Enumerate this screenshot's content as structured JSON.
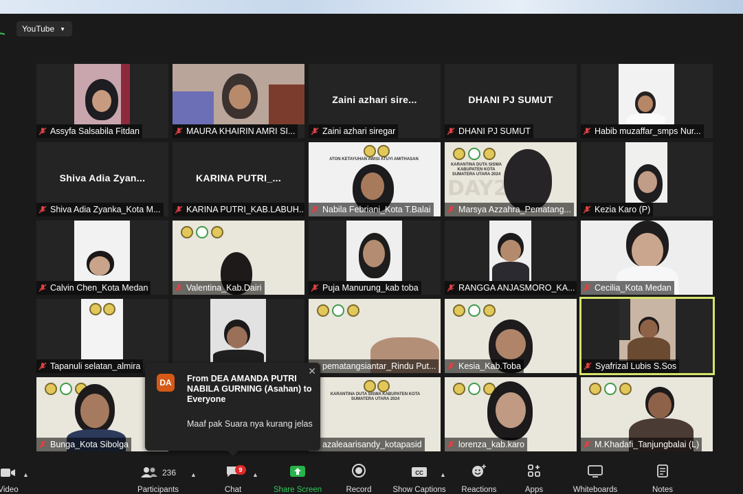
{
  "top_bar": {
    "stream_label": "YouTube"
  },
  "tiles": [
    {
      "name": "Assyfa Salsabila Fitdan",
      "display": ""
    },
    {
      "name": "MAURA KHAIRIN AMRI SI...",
      "display": ""
    },
    {
      "name": "Zaini azhari siregar",
      "display": "Zaini azhari sire..."
    },
    {
      "name": "DHANI PJ SUMUT",
      "display": "DHANI PJ SUMUT"
    },
    {
      "name": "Habib muzaffar_smps Nur...",
      "display": ""
    },
    {
      "name": "Shiva Adia Zyanka_Kota M...",
      "display": "Shiva Adia Zyan..."
    },
    {
      "name": "KARINA PUTRI_KAB.LABUH...",
      "display": "KARINA PUTRI_..."
    },
    {
      "name": "Nabila Febriani_Kota T.Balai",
      "display": ""
    },
    {
      "name": "Marsya Azzahra_Pematang...",
      "display": ""
    },
    {
      "name": "Kezia Karo (P)",
      "display": ""
    },
    {
      "name": "Calvin Chen_Kota Medan",
      "display": ""
    },
    {
      "name": "Valentina_Kab.Dairi",
      "display": ""
    },
    {
      "name": "Puja Manurung_kab toba",
      "display": ""
    },
    {
      "name": "RANGGA ANJASMORO_KA...",
      "display": ""
    },
    {
      "name": "Cecilia_Kota Medan",
      "display": ""
    },
    {
      "name": "Tapanuli selatan_almira",
      "display": ""
    },
    {
      "name": "",
      "display": ""
    },
    {
      "name": "pematangsiantar_Rindu Put...",
      "display": ""
    },
    {
      "name": "Kesia_Kab.Toba",
      "display": ""
    },
    {
      "name": "Syafrizal Lubis S.Sos",
      "display": ""
    },
    {
      "name": "Bunga_Kota Sibolga",
      "display": ""
    },
    {
      "name": "",
      "display": ""
    },
    {
      "name": "azaleaarisandy_kotapasid",
      "display": ""
    },
    {
      "name": "lorenza_kab.karo",
      "display": ""
    },
    {
      "name": "M.Khadafi_Tanjungbalai (L)",
      "display": ""
    }
  ],
  "banner_text": {
    "title": "KARANTINA DUTA SISWA KABUPATEN KOTA SUMATERA UTARA 2024",
    "title_short": "KARANTINA DUTA SISWA KABUPATEN KOTA SUMATERA UTARA 2024",
    "day": "DAY2",
    "motto": "ATON KETAYUHAN AWISI ATUYI AMITHASAN"
  },
  "chat_popup": {
    "avatar_initials": "DA",
    "from": "From DEA AMANDA PUTRI NABILA GURNING (Asahan) to Everyone",
    "message": "Maaf pak Suara nya kurang jelas"
  },
  "toolbar": {
    "video_label": "Video",
    "participants_label": "Participants",
    "participants_count": "236",
    "chat_label": "Chat",
    "chat_badge": "9",
    "share_label": "Share Screen",
    "record_label": "Record",
    "captions_label": "Show Captions",
    "reactions_label": "Reactions",
    "apps_label": "Apps",
    "whiteboards_label": "Whiteboards",
    "notes_label": "Notes"
  },
  "colors": {
    "active_speaker": "#d7e36a",
    "share_green": "#34c759",
    "badge_red": "#e02828",
    "avatar_orange": "#d55a17"
  }
}
